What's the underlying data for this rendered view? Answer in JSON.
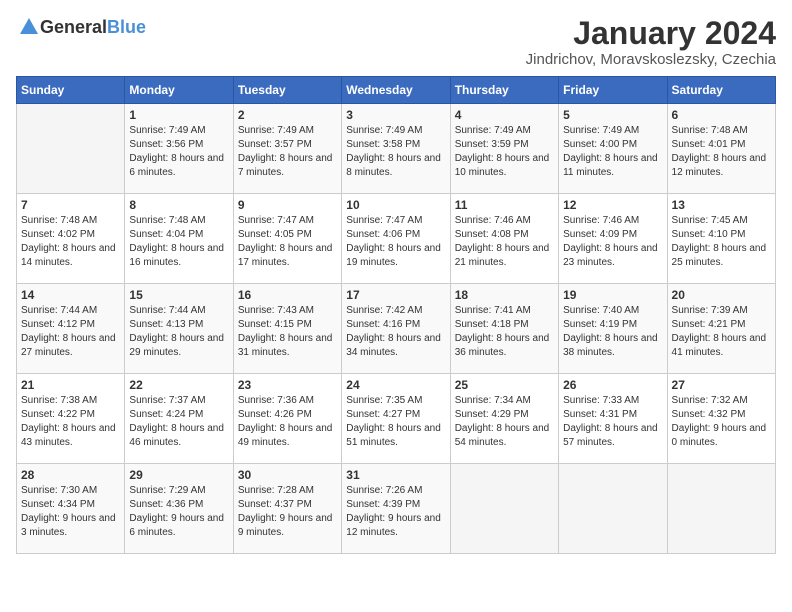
{
  "header": {
    "logo_general": "General",
    "logo_blue": "Blue",
    "title": "January 2024",
    "subtitle": "Jindrichov, Moravskoslezsky, Czechia"
  },
  "weekdays": [
    "Sunday",
    "Monday",
    "Tuesday",
    "Wednesday",
    "Thursday",
    "Friday",
    "Saturday"
  ],
  "weeks": [
    [
      {
        "day": "",
        "sunrise": "",
        "sunset": "",
        "daylight": ""
      },
      {
        "day": "1",
        "sunrise": "Sunrise: 7:49 AM",
        "sunset": "Sunset: 3:56 PM",
        "daylight": "Daylight: 8 hours and 6 minutes."
      },
      {
        "day": "2",
        "sunrise": "Sunrise: 7:49 AM",
        "sunset": "Sunset: 3:57 PM",
        "daylight": "Daylight: 8 hours and 7 minutes."
      },
      {
        "day": "3",
        "sunrise": "Sunrise: 7:49 AM",
        "sunset": "Sunset: 3:58 PM",
        "daylight": "Daylight: 8 hours and 8 minutes."
      },
      {
        "day": "4",
        "sunrise": "Sunrise: 7:49 AM",
        "sunset": "Sunset: 3:59 PM",
        "daylight": "Daylight: 8 hours and 10 minutes."
      },
      {
        "day": "5",
        "sunrise": "Sunrise: 7:49 AM",
        "sunset": "Sunset: 4:00 PM",
        "daylight": "Daylight: 8 hours and 11 minutes."
      },
      {
        "day": "6",
        "sunrise": "Sunrise: 7:48 AM",
        "sunset": "Sunset: 4:01 PM",
        "daylight": "Daylight: 8 hours and 12 minutes."
      }
    ],
    [
      {
        "day": "7",
        "sunrise": "Sunrise: 7:48 AM",
        "sunset": "Sunset: 4:02 PM",
        "daylight": "Daylight: 8 hours and 14 minutes."
      },
      {
        "day": "8",
        "sunrise": "Sunrise: 7:48 AM",
        "sunset": "Sunset: 4:04 PM",
        "daylight": "Daylight: 8 hours and 16 minutes."
      },
      {
        "day": "9",
        "sunrise": "Sunrise: 7:47 AM",
        "sunset": "Sunset: 4:05 PM",
        "daylight": "Daylight: 8 hours and 17 minutes."
      },
      {
        "day": "10",
        "sunrise": "Sunrise: 7:47 AM",
        "sunset": "Sunset: 4:06 PM",
        "daylight": "Daylight: 8 hours and 19 minutes."
      },
      {
        "day": "11",
        "sunrise": "Sunrise: 7:46 AM",
        "sunset": "Sunset: 4:08 PM",
        "daylight": "Daylight: 8 hours and 21 minutes."
      },
      {
        "day": "12",
        "sunrise": "Sunrise: 7:46 AM",
        "sunset": "Sunset: 4:09 PM",
        "daylight": "Daylight: 8 hours and 23 minutes."
      },
      {
        "day": "13",
        "sunrise": "Sunrise: 7:45 AM",
        "sunset": "Sunset: 4:10 PM",
        "daylight": "Daylight: 8 hours and 25 minutes."
      }
    ],
    [
      {
        "day": "14",
        "sunrise": "Sunrise: 7:44 AM",
        "sunset": "Sunset: 4:12 PM",
        "daylight": "Daylight: 8 hours and 27 minutes."
      },
      {
        "day": "15",
        "sunrise": "Sunrise: 7:44 AM",
        "sunset": "Sunset: 4:13 PM",
        "daylight": "Daylight: 8 hours and 29 minutes."
      },
      {
        "day": "16",
        "sunrise": "Sunrise: 7:43 AM",
        "sunset": "Sunset: 4:15 PM",
        "daylight": "Daylight: 8 hours and 31 minutes."
      },
      {
        "day": "17",
        "sunrise": "Sunrise: 7:42 AM",
        "sunset": "Sunset: 4:16 PM",
        "daylight": "Daylight: 8 hours and 34 minutes."
      },
      {
        "day": "18",
        "sunrise": "Sunrise: 7:41 AM",
        "sunset": "Sunset: 4:18 PM",
        "daylight": "Daylight: 8 hours and 36 minutes."
      },
      {
        "day": "19",
        "sunrise": "Sunrise: 7:40 AM",
        "sunset": "Sunset: 4:19 PM",
        "daylight": "Daylight: 8 hours and 38 minutes."
      },
      {
        "day": "20",
        "sunrise": "Sunrise: 7:39 AM",
        "sunset": "Sunset: 4:21 PM",
        "daylight": "Daylight: 8 hours and 41 minutes."
      }
    ],
    [
      {
        "day": "21",
        "sunrise": "Sunrise: 7:38 AM",
        "sunset": "Sunset: 4:22 PM",
        "daylight": "Daylight: 8 hours and 43 minutes."
      },
      {
        "day": "22",
        "sunrise": "Sunrise: 7:37 AM",
        "sunset": "Sunset: 4:24 PM",
        "daylight": "Daylight: 8 hours and 46 minutes."
      },
      {
        "day": "23",
        "sunrise": "Sunrise: 7:36 AM",
        "sunset": "Sunset: 4:26 PM",
        "daylight": "Daylight: 8 hours and 49 minutes."
      },
      {
        "day": "24",
        "sunrise": "Sunrise: 7:35 AM",
        "sunset": "Sunset: 4:27 PM",
        "daylight": "Daylight: 8 hours and 51 minutes."
      },
      {
        "day": "25",
        "sunrise": "Sunrise: 7:34 AM",
        "sunset": "Sunset: 4:29 PM",
        "daylight": "Daylight: 8 hours and 54 minutes."
      },
      {
        "day": "26",
        "sunrise": "Sunrise: 7:33 AM",
        "sunset": "Sunset: 4:31 PM",
        "daylight": "Daylight: 8 hours and 57 minutes."
      },
      {
        "day": "27",
        "sunrise": "Sunrise: 7:32 AM",
        "sunset": "Sunset: 4:32 PM",
        "daylight": "Daylight: 9 hours and 0 minutes."
      }
    ],
    [
      {
        "day": "28",
        "sunrise": "Sunrise: 7:30 AM",
        "sunset": "Sunset: 4:34 PM",
        "daylight": "Daylight: 9 hours and 3 minutes."
      },
      {
        "day": "29",
        "sunrise": "Sunrise: 7:29 AM",
        "sunset": "Sunset: 4:36 PM",
        "daylight": "Daylight: 9 hours and 6 minutes."
      },
      {
        "day": "30",
        "sunrise": "Sunrise: 7:28 AM",
        "sunset": "Sunset: 4:37 PM",
        "daylight": "Daylight: 9 hours and 9 minutes."
      },
      {
        "day": "31",
        "sunrise": "Sunrise: 7:26 AM",
        "sunset": "Sunset: 4:39 PM",
        "daylight": "Daylight: 9 hours and 12 minutes."
      },
      {
        "day": "",
        "sunrise": "",
        "sunset": "",
        "daylight": ""
      },
      {
        "day": "",
        "sunrise": "",
        "sunset": "",
        "daylight": ""
      },
      {
        "day": "",
        "sunrise": "",
        "sunset": "",
        "daylight": ""
      }
    ]
  ]
}
